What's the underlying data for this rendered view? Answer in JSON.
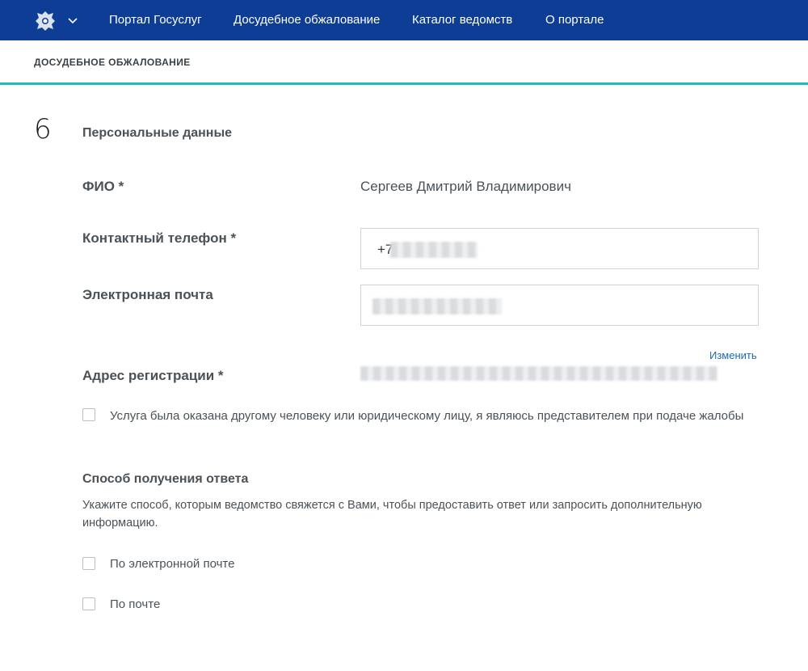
{
  "header": {
    "nav": [
      "Портал Госуслуг",
      "Досудебное обжалование",
      "Каталог ведомств",
      "О портале"
    ]
  },
  "subheader": {
    "title": "ДОСУДЕБНОЕ ОБЖАЛОВАНИЕ"
  },
  "step": {
    "number": "6",
    "title": "Персональные данные"
  },
  "fields": {
    "fio_label": "ФИО *",
    "fio_value": "Сергеев Дмитрий Владимирович",
    "phone_label": "Контактный телефон *",
    "phone_prefix": "+7",
    "email_label": "Электронная почта",
    "change_link": "Изменить",
    "address_label": "Адрес регистрации *"
  },
  "representative_checkbox": {
    "label": "Услуга была оказана другому человеку или юридическому лицу, я являюсь представителем при подаче жалобы",
    "checked": false
  },
  "response": {
    "title": "Способ получения ответа",
    "hint": "Укажите способ, которым ведомство свяжется с Вами, чтобы предоставить ответ или запросить дополнительную информацию.",
    "options": [
      {
        "label": "По электронной почте",
        "checked": false
      },
      {
        "label": "По почте",
        "checked": false
      }
    ]
  }
}
